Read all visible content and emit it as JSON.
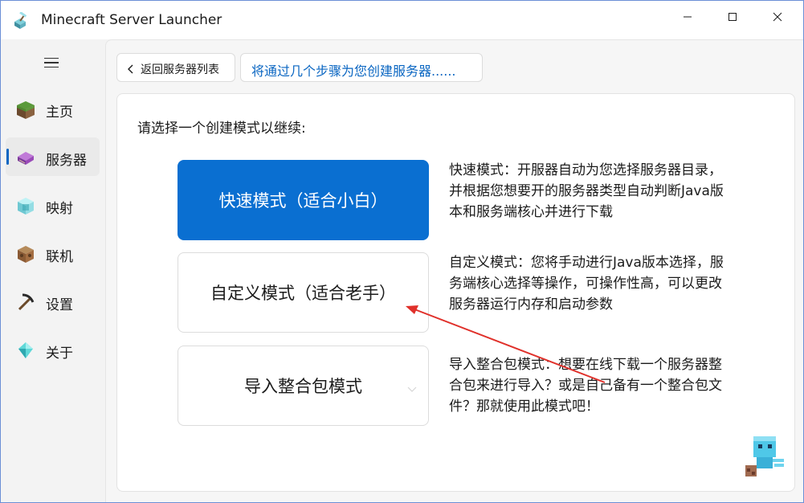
{
  "window": {
    "title": "Minecraft Server Launcher",
    "icon": "pickaxe-block-icon",
    "controls": [
      "minimize-icon",
      "maximize-icon",
      "close-icon"
    ]
  },
  "sidebar": {
    "menu_icon": "hamburger-menu-icon",
    "items": [
      {
        "label": "主页",
        "icon": "grass-block-icon",
        "active": false
      },
      {
        "label": "服务器",
        "icon": "enchanted-book-icon",
        "active": true
      },
      {
        "label": "映射",
        "icon": "beacon-icon",
        "active": false
      },
      {
        "label": "联机",
        "icon": "crafting-table-icon",
        "active": false
      },
      {
        "label": "设置",
        "icon": "pickaxe-icon",
        "active": false
      },
      {
        "label": "关于",
        "icon": "diamond-icon",
        "active": false
      }
    ]
  },
  "toolbar": {
    "back_label": "返回服务器列表",
    "step_label": "将通过几个步骤为您创建服务器......"
  },
  "content": {
    "prompt": "请选择一个创建模式以继续:",
    "modes": [
      {
        "label": "快速模式（适合小白）",
        "description": "快速模式：开服器自动为您选择服务器目录，并根据您想要开的服务器类型自动判断Java版本和服务端核心并进行下载"
      },
      {
        "label": "自定义模式（适合老手）",
        "description": "自定义模式：您将手动进行Java版本选择，服务端核心选择等操作，可操作性高，可以更改服务器运行内存和启动参数"
      },
      {
        "label": "导入整合包模式",
        "description": "导入整合包模式：想要在线下载一个服务器整合包来进行导入？或是自己备有一个整合包文件？那就使用此模式吧！"
      }
    ],
    "mascot_icon": "allay-mascot-icon"
  },
  "colors": {
    "accent": "#0a6fd1",
    "arrow": "#e0302a"
  }
}
